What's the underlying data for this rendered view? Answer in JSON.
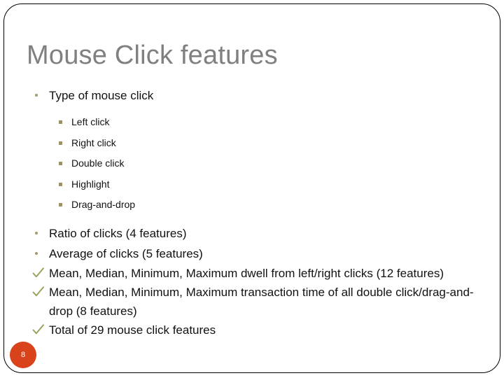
{
  "slide": {
    "title": "Mouse Click features",
    "page_number": "8",
    "accent_colors": {
      "title_gray": "#808080",
      "bullet_khaki": "#9c9167",
      "check_olive": "#9aa05a",
      "page_badge_orange": "#d8431b",
      "frame_border": "#000000",
      "body_text": "#111111"
    },
    "blocks": [
      {
        "level": 1,
        "marker": "dot-bullet",
        "text": "Type of mouse click"
      },
      {
        "level": 2,
        "marker": "square-bullet",
        "text": "Left click"
      },
      {
        "level": 2,
        "marker": "square-bullet",
        "text": "Right click"
      },
      {
        "level": 2,
        "marker": "square-bullet",
        "text": "Double click"
      },
      {
        "level": 2,
        "marker": "square-bullet",
        "text": "Highlight"
      },
      {
        "level": 2,
        "marker": "square-bullet",
        "text": "Drag-and-drop"
      },
      {
        "level": 1,
        "marker": "dot-bullet",
        "text": "Ratio of clicks (4 features)"
      },
      {
        "level": 1,
        "marker": "dot-bullet",
        "text": "Average of clicks (5 features)"
      },
      {
        "level": 1,
        "marker": "check-bullet",
        "text": "Mean, Median, Minimum, Maximum dwell from left/right clicks (12 features)"
      },
      {
        "level": 1,
        "marker": "check-bullet",
        "text": "Mean, Median, Minimum, Maximum transaction time of all double click/drag-and-drop (8 features)"
      },
      {
        "level": 1,
        "marker": "check-bullet",
        "text": "Total of 29 mouse click features"
      }
    ]
  }
}
